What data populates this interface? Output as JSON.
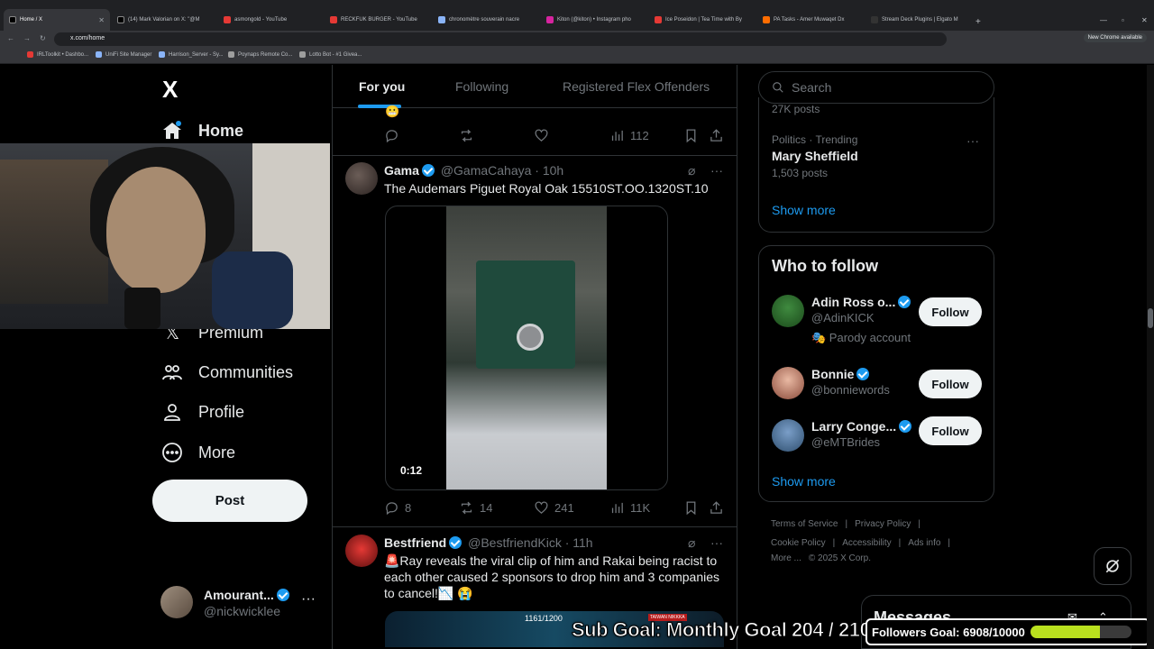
{
  "browser": {
    "tabs": [
      {
        "label": "Home / X",
        "active": true
      },
      {
        "label": "(14) Mark Valorian on X: \"@M"
      },
      {
        "label": "asmongold - YouTube"
      },
      {
        "label": "RECKFUK BURGER - YouTube"
      },
      {
        "label": "chronomètre souverain nacre"
      },
      {
        "label": "Kiton (@kiton) • Instagram pho"
      },
      {
        "label": "Ice Poseidon | Tea Time with By"
      },
      {
        "label": "PA Tasks - Amer Muwaqet Dx"
      },
      {
        "label": "Stream Deck Plugins | Elgato M"
      }
    ],
    "url": "x.com/home",
    "new_chrome": "New Chrome available",
    "bookmarks": [
      "IRLToolkit • Dashbo...",
      "UniFi Site Manager",
      "Harrison_Server - Sy...",
      "Poynaps Remote Co...",
      "Lotto Bot - #1 Givea..."
    ]
  },
  "sidebar": {
    "logo": "X",
    "items": [
      {
        "label": "Home",
        "icon": "home-icon"
      },
      {
        "label": "Premium",
        "icon": "x-logo-icon"
      },
      {
        "label": "Communities",
        "icon": "people-icon"
      },
      {
        "label": "Profile",
        "icon": "person-icon"
      },
      {
        "label": "More",
        "icon": "more-circle-icon"
      }
    ],
    "post_label": "Post",
    "account": {
      "name": "Amourant...",
      "handle": "@nickwicklee",
      "more": "···"
    }
  },
  "feed": {
    "tabs": [
      "For you",
      "Following",
      "Registered Flex Offenders"
    ],
    "prev_tweet": {
      "views": "112",
      "emoji": "😬"
    },
    "tweets": [
      {
        "name": "Gama",
        "handle": "@GamaCahaya",
        "time": "· 10h",
        "text": "The Audemars Piguet Royal Oak 15510ST.OO.1320ST.10",
        "video_time": "0:12",
        "replies": "8",
        "reposts": "14",
        "likes": "241",
        "views": "11K"
      },
      {
        "name": "Bestfriend",
        "handle": "@BestfriendKick",
        "time": "· 11h",
        "text": "🚨Ray reveals the viral clip of him and Rakai being racist to each other caused 2 sponsors to drop him and 3 companies to cancel!📉 😭",
        "media_caption": "1161/1200",
        "media_caption2": "TAIWAN NIKKKA"
      }
    ]
  },
  "right": {
    "search_placeholder": "Search",
    "trend_peek": "27K posts",
    "trend": {
      "category": "Politics · Trending",
      "name": "Mary Sheffield",
      "count": "1,503 posts"
    },
    "show_more": "Show more",
    "who_to_follow": "Who to follow",
    "follow_label": "Follow",
    "suggestions": [
      {
        "name": "Adin Ross o...",
        "handle": "@AdinKICK",
        "note": "🎭 Parody account"
      },
      {
        "name": "Bonnie",
        "handle": "@bonniewords"
      },
      {
        "name": "Larry Conge...",
        "handle": "@eMTBrides"
      }
    ],
    "footer": [
      "Terms of Service",
      "|",
      "Privacy Policy",
      "|",
      "Cookie Policy",
      "|",
      "Accessibility",
      "|",
      "Ads info",
      "|",
      "More ...",
      "© 2025 X Corp."
    ],
    "messages": "Messages"
  },
  "overlay": {
    "sub_goal": "Sub Goal: Monthly Goal  204 / 210",
    "followers_goal": "Followers Goal: 6908/10000",
    "followers_progress": 0.6908
  },
  "colors": {
    "accent": "#1d9bf0",
    "bg": "#000000",
    "progress": "#b9e01e"
  }
}
